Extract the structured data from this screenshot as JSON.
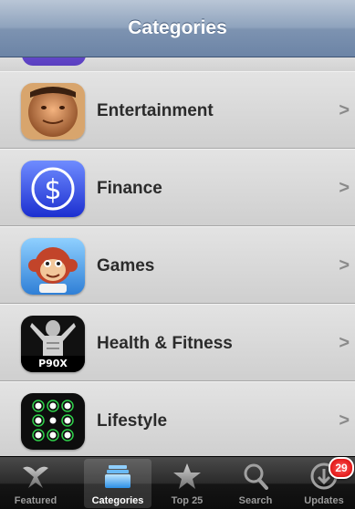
{
  "navbar": {
    "title": "Categories"
  },
  "categories": [
    {
      "label": "Entertainment",
      "icon": "face-icon"
    },
    {
      "label": "Finance",
      "icon": "dollar-icon"
    },
    {
      "label": "Games",
      "icon": "monkey-icon"
    },
    {
      "label": "Health & Fitness",
      "icon": "fitness-icon",
      "icon_text": "P90X"
    },
    {
      "label": "Lifestyle",
      "icon": "dots-grid-icon"
    }
  ],
  "chevron": ">",
  "tabbar": {
    "tabs": [
      {
        "label": "Featured",
        "icon": "featured-icon"
      },
      {
        "label": "Categories",
        "icon": "categories-icon",
        "selected": true
      },
      {
        "label": "Top 25",
        "icon": "star-icon"
      },
      {
        "label": "Search",
        "icon": "search-icon"
      },
      {
        "label": "Updates",
        "icon": "updates-icon",
        "badge": "29"
      }
    ]
  },
  "colors": {
    "navbar": "#7d93b1",
    "badge": "#d60000",
    "tabbar": "#151515"
  }
}
